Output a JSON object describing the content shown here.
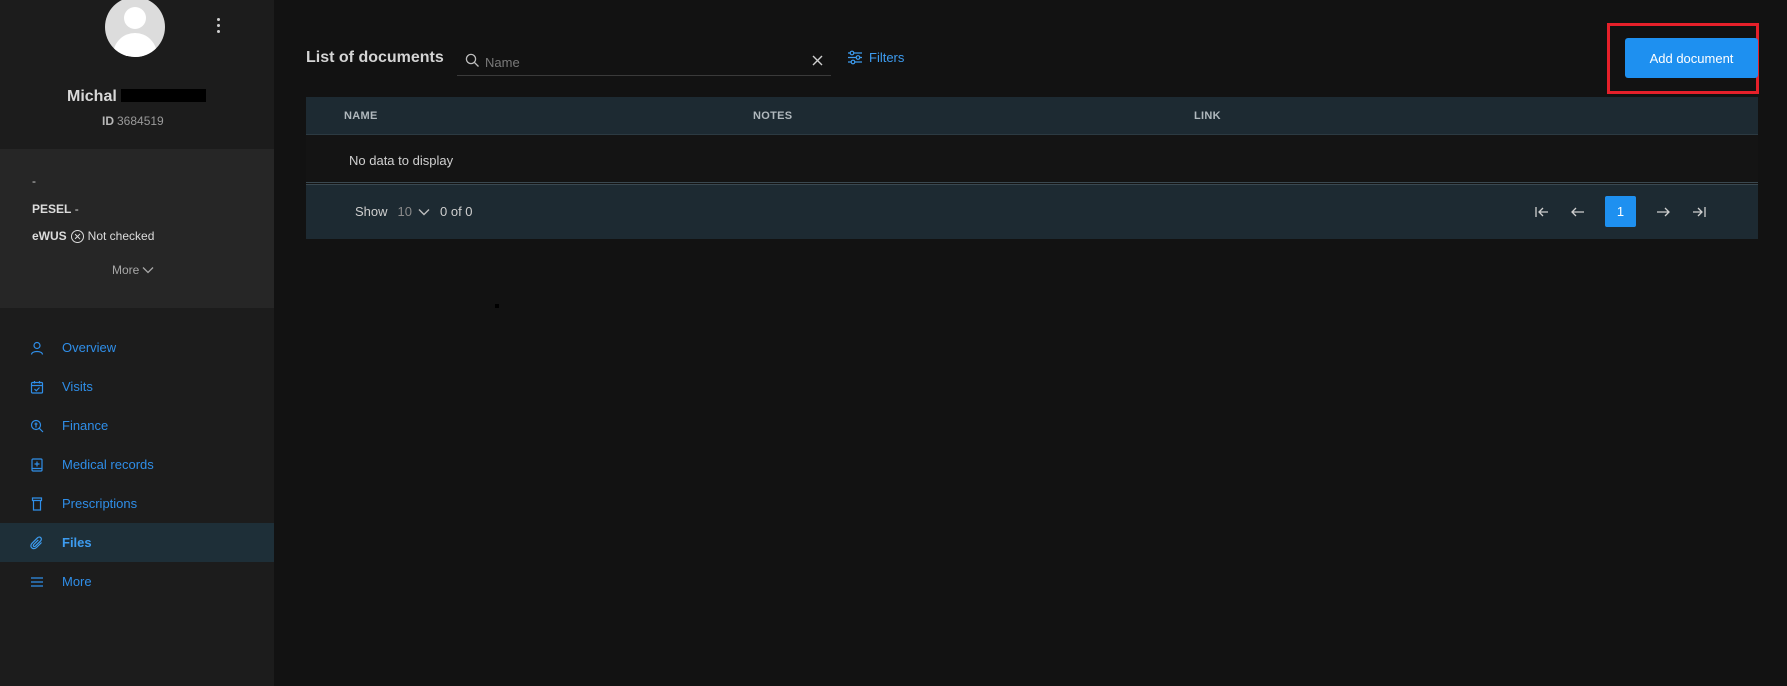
{
  "profile": {
    "name": "Michal",
    "id_label": "ID",
    "id_value": "3684519"
  },
  "info": {
    "dash": "-",
    "pesel_label": "PESEL",
    "pesel_value": "-",
    "ewus_label": "eWUS",
    "ewus_status": "Not checked",
    "more_label": "More"
  },
  "nav": {
    "items": [
      {
        "label": "Overview",
        "icon": "user-icon"
      },
      {
        "label": "Visits",
        "icon": "calendar-icon"
      },
      {
        "label": "Finance",
        "icon": "finance-search-icon"
      },
      {
        "label": "Medical records",
        "icon": "medical-book-icon"
      },
      {
        "label": "Prescriptions",
        "icon": "prescription-icon"
      },
      {
        "label": "Files",
        "icon": "paperclip-icon",
        "active": true
      },
      {
        "label": "More",
        "icon": "menu-icon"
      }
    ]
  },
  "header": {
    "title": "List of documents",
    "search_placeholder": "Name",
    "filters_label": "Filters",
    "add_button": "Add document"
  },
  "table": {
    "columns": [
      "NAME",
      "NOTES",
      "LINK"
    ],
    "empty_text": "No data to display",
    "show_label": "Show",
    "page_size": "10",
    "range_text": "0 of 0",
    "current_page": "1"
  },
  "colors": {
    "accent": "#1e90f0",
    "highlight": "#e5202a"
  }
}
